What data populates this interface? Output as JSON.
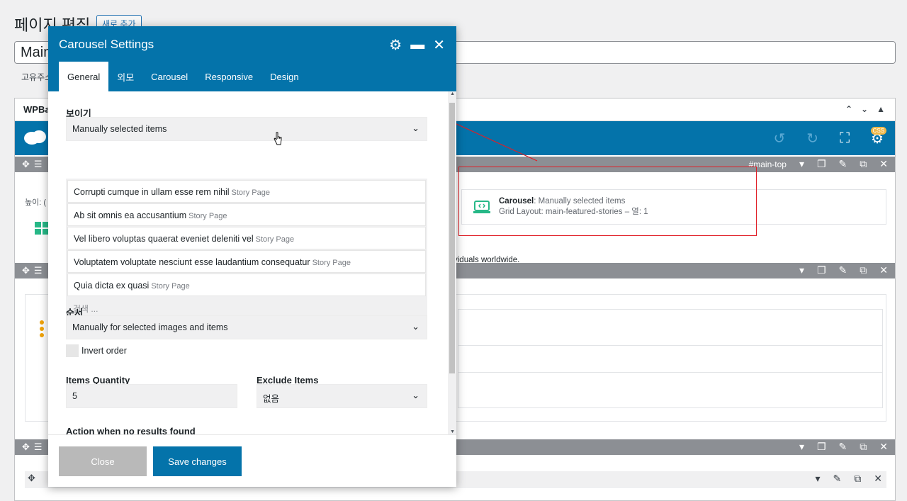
{
  "editor": {
    "title": "페이지 편집",
    "add_new": "새로 추가",
    "post_title_value": "Main",
    "permalink_label": "고유주소",
    "builder_label": "WPBal",
    "height_label": "높이: (",
    "row_tag": "#main-top",
    "info_text": "viduals worldwide.",
    "css_badge": "CSS"
  },
  "carousel_card": {
    "name": "Carousel",
    "value": ": Manually selected items",
    "line2": "Grid Layout: main-featured-stories –  열: 1"
  },
  "modal": {
    "title": "Carousel Settings",
    "tabs": [
      {
        "label": "General",
        "active": true
      },
      {
        "label": "외모",
        "active": false
      },
      {
        "label": "Carousel",
        "active": false
      },
      {
        "label": "Responsive",
        "active": false
      },
      {
        "label": "Design",
        "active": false
      }
    ],
    "display": {
      "label": "보이기",
      "selected": "Manually selected items",
      "items": [
        {
          "title": "Corrupti cumque in ullam esse rem nihil",
          "type": "Story Page"
        },
        {
          "title": "Ab sit omnis ea accusantium",
          "type": "Story Page"
        },
        {
          "title": "Vel libero voluptas quaerat eveniet deleniti vel",
          "type": "Story Page"
        },
        {
          "title": "Voluptatem voluptate nesciunt esse laudantium consequatur",
          "type": "Story Page"
        },
        {
          "title": "Quia dicta ex quasi",
          "type": "Story Page"
        }
      ],
      "search_placeholder": "검색 ..."
    },
    "order": {
      "label": "순서",
      "selected": "Manually for selected images and items",
      "invert_label": "Invert order"
    },
    "items_quantity": {
      "label": "Items Quantity",
      "value": "5"
    },
    "exclude_items": {
      "label": "Exclude Items",
      "selected": "없음"
    },
    "no_results": {
      "label": "Action when no results found"
    },
    "buttons": {
      "close": "Close",
      "save": "Save changes"
    }
  },
  "colors": {
    "brand_blue": "#0473aa",
    "annotation_red": "#e01e26",
    "accent_green": "#27b887",
    "accent_orange": "#f0a30a"
  }
}
